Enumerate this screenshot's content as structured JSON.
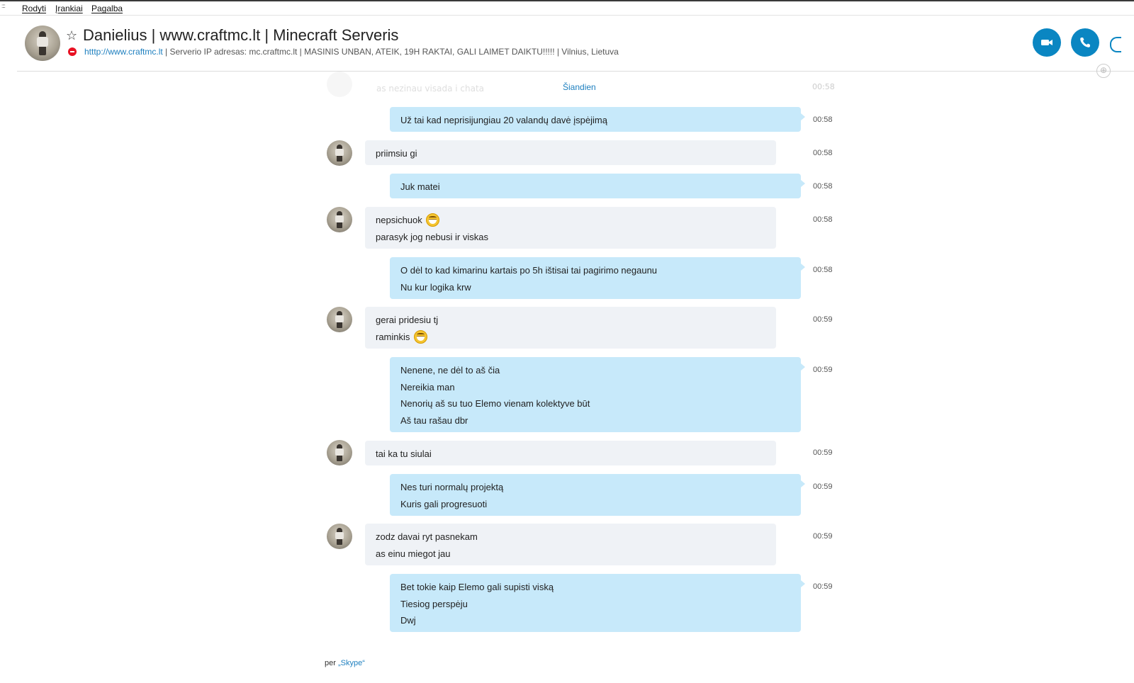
{
  "menu": {
    "dots": "::::",
    "items": [
      "Rodyti",
      "Įrankiai",
      "Pagalba"
    ]
  },
  "header": {
    "contact_name": "Danielius | www.craftmc.lt | Minecraft Serveris",
    "mood_link": "htttp://www.craftmc.lt",
    "mood_rest": " | Serverio IP adresas: mc.craftmc.lt | MASINIS UNBAN, ATEIK, 19H RAKTAI, GALI LAIMET DAIKTU!!!!!  |  Vilnius, Lietuva",
    "status": "do-not-disturb",
    "video_call_icon": "video-camera-icon",
    "audio_call_icon": "phone-icon",
    "accent_color": "#0a86c2"
  },
  "conversation": {
    "ghost_text": "as nezinau visada i chata",
    "ghost_time": "00:58",
    "date_separator": "Šiandien",
    "messages": [
      {
        "dir": "out",
        "lines": [
          "Už tai kad neprisijungiau 20 valandų davė įspėjimą"
        ],
        "time": "00:58"
      },
      {
        "dir": "in",
        "lines": [
          "priimsiu gi"
        ],
        "time": "00:58"
      },
      {
        "dir": "out",
        "lines": [
          "Juk matei"
        ],
        "time": "00:58"
      },
      {
        "dir": "in",
        "lines": [
          "nepsichuok",
          "parasyk jog nebusi ir viskas"
        ],
        "time": "00:58"
      },
      {
        "dir": "out",
        "lines": [
          "O dėl to kad kimarinu kartais po 5h ištisai tai pagirimo negaunu",
          "Nu kur logika krw"
        ],
        "time": "00:58"
      },
      {
        "dir": "in",
        "lines": [
          "gerai pridesiu tj",
          "raminkis"
        ],
        "time": "00:59"
      },
      {
        "dir": "out",
        "lines": [
          "Nenene, ne dėl to aš čia",
          "Nereikia man",
          "Nenorių aš su tuo Elemo vienam kolektyve būt",
          "Aš tau rašau dbr"
        ],
        "time": "00:59"
      },
      {
        "dir": "in",
        "lines": [
          "tai ka tu siulai"
        ],
        "time": "00:59"
      },
      {
        "dir": "out",
        "lines": [
          "Nes turi normalų projektą",
          "Kuris gali progresuoti"
        ],
        "time": "00:59"
      },
      {
        "dir": "in",
        "lines": [
          "zodz davai ryt pasnekam",
          "as einu miegot jau"
        ],
        "time": "00:59"
      },
      {
        "dir": "out",
        "lines": [
          "Bet tokie kaip Elemo gali supisti viską",
          "Tiesiog perspėju",
          "Dwj"
        ],
        "time": "00:59"
      }
    ],
    "via_prefix": "per ",
    "via_link": "„Skype“",
    "emoji_name": "grin-emoji-icon"
  }
}
